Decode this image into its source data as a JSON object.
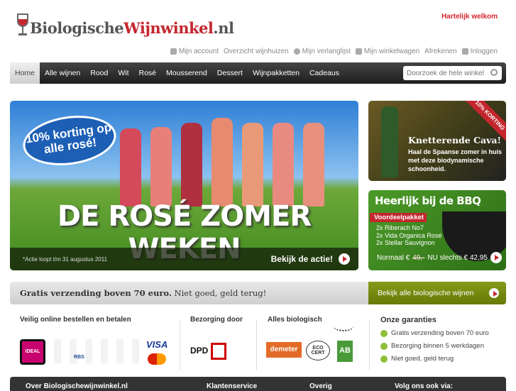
{
  "header": {
    "logo_text_a": "Biologische",
    "logo_text_b": "Wijnwinkel",
    "logo_text_c": ".nl",
    "welcome": "Hartelijk welkom"
  },
  "toplinks": [
    {
      "label": "Mijn account",
      "icon": "user-icon"
    },
    {
      "label": "Overzicht wijnhuizen"
    },
    {
      "label": "Mijn verlanglijst",
      "icon": "heart-icon"
    },
    {
      "label": "Mijn winkelwagen",
      "icon": "cart-icon"
    },
    {
      "label": "Afrekenen"
    },
    {
      "label": "Inloggen",
      "icon": "lock-icon"
    }
  ],
  "nav": [
    "Home",
    "Alle wijnen",
    "Rood",
    "Wit",
    "Rosé",
    "Mousserend",
    "Dessert",
    "Wijnpakketten",
    "Cadeaus"
  ],
  "search": {
    "placeholder": "Doorzoek de hele winkel"
  },
  "hero": {
    "badge": "10% korting op alle rosé!",
    "headline": "DE ROSÉ ZOMER WEKEN",
    "note": "*Actie loopt t/m 31 augustus 2011",
    "cta": "Bekijk de actie!"
  },
  "cava": {
    "ribbon": "10% KORTING",
    "title": "Knetterende Cava!",
    "text": "Haal de Spaanse zomer in huis met deze biodynamische schoonheid."
  },
  "bbq": {
    "title": "Heerlijk bij de BBQ",
    "tag": "Voordeelpakket",
    "items": [
      "2x Riberach No7",
      "2x Vida Organica Rosé",
      "2x Stellar Sauvignon"
    ],
    "normal_label": "Normaal €",
    "old_price": "49,-",
    "now": "NU slechts € 42,95"
  },
  "promo": {
    "bold": "Gratis verzending boven 70 euro.",
    "rest": "Niet goed, geld terug!",
    "button": "Bekijk alle biologische wijnen"
  },
  "info": {
    "pay_title": "Veilig online bestellen en betalen",
    "ideal": "iDEAL",
    "visa": "VISA",
    "rbs": "RBS",
    "delivery_title": "Bezorging door",
    "dpd": "DPD",
    "bio_title": "Alles biologisch",
    "demeter": "demeter",
    "ecocert": "ECO CERT",
    "ab": "AB",
    "guarantee_title": "Onze garanties",
    "guarantees": [
      "Gratis verzending boven 70 euro",
      "Bezorging binnen 5 werkdagen",
      "Niet goed, geld terug"
    ]
  },
  "footer": [
    "Over Biologischewijnwinkel.nl",
    "Klantenservice",
    "Overig",
    "Volg ons ook via:"
  ]
}
